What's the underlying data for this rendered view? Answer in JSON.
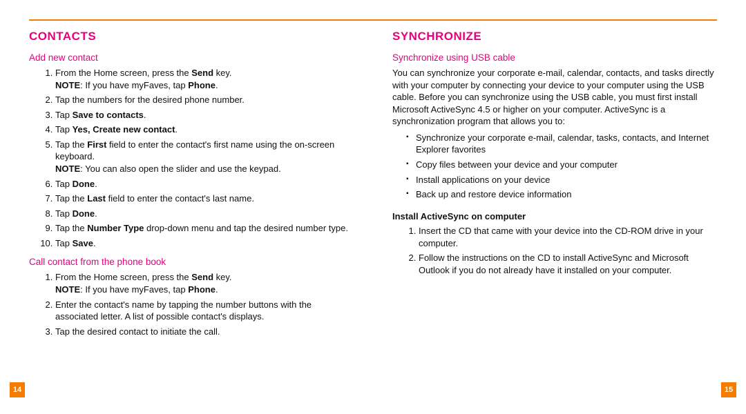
{
  "accent_orange": "#f57c00",
  "accent_magenta": "#e6007e",
  "page_left_number": "14",
  "page_right_number": "15",
  "note_label": "NOTE",
  "left": {
    "heading": "CONTACTS",
    "section_a": {
      "title": "Add new contact",
      "steps": [
        {
          "pre": "From the Home screen, press the ",
          "b1": "Send",
          "post": " key."
        },
        {
          "note_pre": "If you have myFaves, tap ",
          "note_b": "Phone",
          "note_post": "."
        },
        {
          "plain": "Tap the numbers for the desired phone number."
        },
        {
          "pre": "Tap ",
          "b1": "Save to contacts",
          "post": "."
        },
        {
          "pre": "Tap ",
          "b1": "Yes, Create new contact",
          "post": "."
        },
        {
          "pre": "Tap the ",
          "b1": "First",
          "post": " field to enter the contact's first name using the on-screen keyboard."
        },
        {
          "note_plain": "You can also open the slider and use the keypad."
        },
        {
          "pre": "Tap ",
          "b1": "Done",
          "post": "."
        },
        {
          "pre": "Tap the ",
          "b1": "Last",
          "post": " field to enter the contact's last name."
        },
        {
          "pre": "Tap ",
          "b1": "Done",
          "post": "."
        },
        {
          "pre": "Tap the ",
          "b1": "Number Type",
          "post": " drop-down menu and tap the desired number type."
        },
        {
          "pre": "Tap ",
          "b1": "Save",
          "post": "."
        }
      ]
    },
    "section_b": {
      "title": "Call contact from the phone book",
      "steps": [
        {
          "pre": "From the Home screen, press the ",
          "b1": "Send",
          "post": " key."
        },
        {
          "note_pre": "If you have myFaves, tap ",
          "note_b": "Phone",
          "note_post": "."
        },
        {
          "plain": "Enter the contact's name by tapping the number buttons with the associated letter. A list of possible contact's displays."
        },
        {
          "plain": "Tap the desired contact to initiate the call."
        }
      ]
    }
  },
  "right": {
    "heading": "SYNCHRONIZE",
    "section_a": {
      "title": "Synchronize using USB cable",
      "intro": "You can synchronize your corporate e-mail, calendar, contacts, and tasks directly with your computer by connecting your device to your computer using the USB cable. Before you can synchronize using the USB cable, you must first install Microsoft ActiveSync 4.5 or higher on your computer. ActiveSync is a synchronization program that allows you to:",
      "bullets": [
        "Synchronize your corporate e-mail, calendar, tasks, contacts, and Internet Explorer favorites",
        "Copy files between your device and your computer",
        "Install applications on your device",
        "Back up and restore device information"
      ]
    },
    "section_b": {
      "title": "Install ActiveSync on computer",
      "steps": [
        "Insert the CD that came with your device into the CD-ROM drive in your computer.",
        "Follow the instructions on the CD to install ActiveSync and Microsoft Outlook if you do not already have it installed on your computer."
      ]
    }
  }
}
